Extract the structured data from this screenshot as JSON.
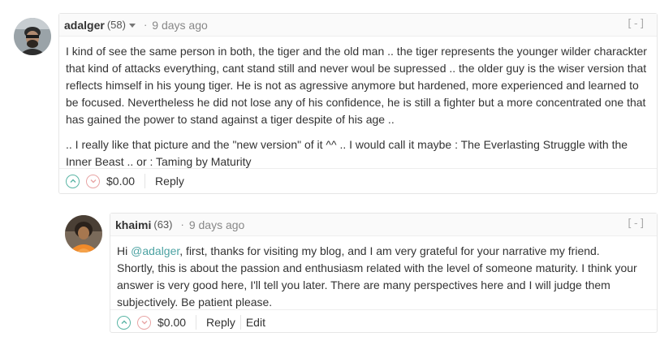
{
  "comments": [
    {
      "author": "adalger",
      "reputation": "(58)",
      "time_ago": "9 days ago",
      "collapse": "[-]",
      "paragraphs": [
        "I kind of see the same person in both, the tiger and the old man .. the tiger represents the younger wilder charackter that kind of attacks everything, cant stand still and never woul be supressed .. the older guy is the wiser version that reflects himself in his young tiger. He is not as agressive anymore but hardened, more experienced and learned to be focused. Nevertheless he did not lose any of his confidence, he is still a fighter but a more concentrated one that has gained the power to stand against a tiger despite of his age ..",
        ".. I really like that picture and the \"new version\" of it ^^ .. I would call it maybe : The Everlasting Struggle with the Inner Beast .. or : Taming by Maturity"
      ],
      "payout": "$0.00",
      "reply_label": "Reply"
    },
    {
      "author": "khaimi",
      "reputation": "(63)",
      "time_ago": "9 days ago",
      "collapse": "[-]",
      "greeting": "Hi ",
      "mention": "@adalger",
      "first_line_rest": ", first, thanks for visiting my blog, and I am very grateful for your narrative my friend.",
      "rest_text": "Shortly, this is about the passion and enthusiasm related with the level of someone maturity. I think your answer is very good here, I'll tell you later. There are many perspectives here and I will judge them subjectively. Be patient please.",
      "payout": "$0.00",
      "reply_label": "Reply",
      "edit_label": "Edit"
    }
  ],
  "colors": {
    "upvote": "#5ab5a5",
    "downvote": "#e8a5a5",
    "mention": "#4ba2a2"
  }
}
